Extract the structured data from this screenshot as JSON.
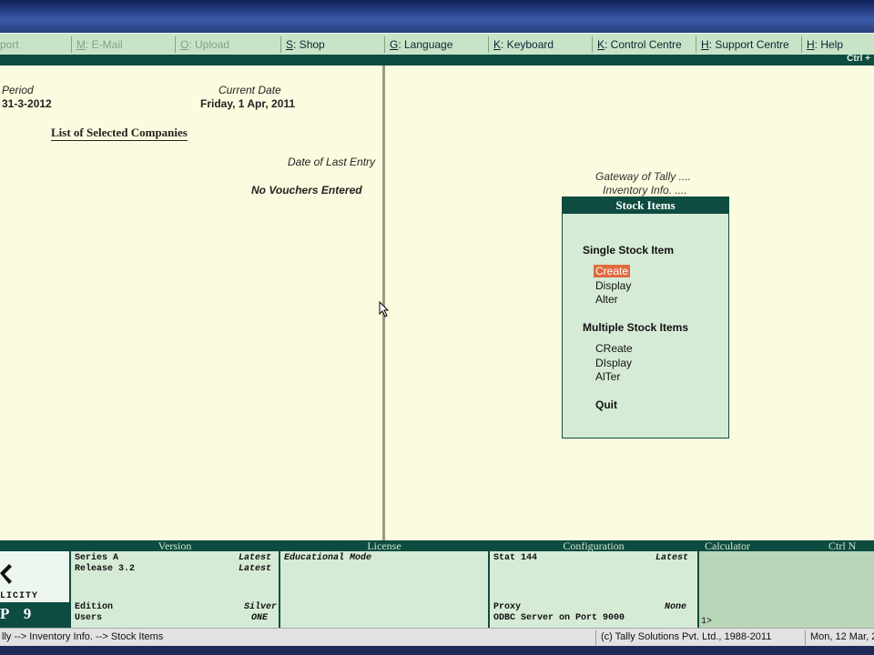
{
  "menu": [
    {
      "label": "port",
      "disabled": true
    },
    {
      "hotkey": "M",
      "label": ": E-Mail",
      "disabled": true
    },
    {
      "hotkey": "O",
      "label": ": Upload",
      "disabled": true
    },
    {
      "hotkey": "S",
      "label": ": Shop",
      "disabled": false
    },
    {
      "hotkey": "G",
      "label": ": Language",
      "disabled": false
    },
    {
      "hotkey": "K",
      "label": ": Keyboard",
      "disabled": false
    },
    {
      "hotkey": "K",
      "label": ": Control Centre",
      "disabled": false
    },
    {
      "hotkey": "H",
      "label": ": Support Centre",
      "disabled": false
    },
    {
      "hotkey": "H",
      "label": ": Help",
      "disabled": false
    }
  ],
  "ctrl_top": "Ctrl +",
  "left": {
    "period_label": "Period",
    "period_value": "31-3-2012",
    "current_date_label": "Current Date",
    "current_date_value": "Friday, 1 Apr, 2011",
    "list_title": "List of Selected Companies",
    "date_last_entry_label": "Date of Last Entry",
    "no_vouchers": "No Vouchers Entered"
  },
  "gateway": {
    "line1": "Gateway of Tally ....",
    "line2": "Inventory Info. ...."
  },
  "panel": {
    "title": "Stock Items",
    "section1": "Single Stock Item",
    "opt_create": "Create",
    "opt_display": "Display",
    "opt_alter": "Alter",
    "section2": "Multiple Stock Items",
    "opt_mcreate": "CReate",
    "opt_mdisplay": "DIsplay",
    "opt_malter": "AlTer",
    "opt_quit": "Quit"
  },
  "bottom": {
    "logo_text": "LICITY",
    "logo_brand": "P 9",
    "version_head": "Version",
    "series": "Series A",
    "series_val": "Latest",
    "release": "Release 3.2",
    "release_val": "Latest",
    "edition": "Edition",
    "edition_val": "Silver",
    "users": "Users",
    "users_val": "ONE",
    "license_head": "License",
    "license_mode": "Educational Mode",
    "config_head": "Configuration",
    "stat": "Stat  144",
    "stat_val": "Latest",
    "proxy": "Proxy",
    "proxy_val": "None",
    "odbc": "ODBC Server on Port 9000",
    "calc_head": "Calculator",
    "calc_ctrl": "Ctrl N",
    "calc_cursor": "1>"
  },
  "status": {
    "breadcrumb": "lly --> Inventory Info. --> Stock Items",
    "copyright": "(c) Tally Solutions Pvt. Ltd., 1988-2011",
    "datetime": "Mon, 12 Mar, 2"
  },
  "colors": {
    "accent_dark_green": "#0e4b40",
    "menu_green": "#c8e4c8",
    "main_bg": "#fbfbdf",
    "selected": "#e06a3e"
  }
}
